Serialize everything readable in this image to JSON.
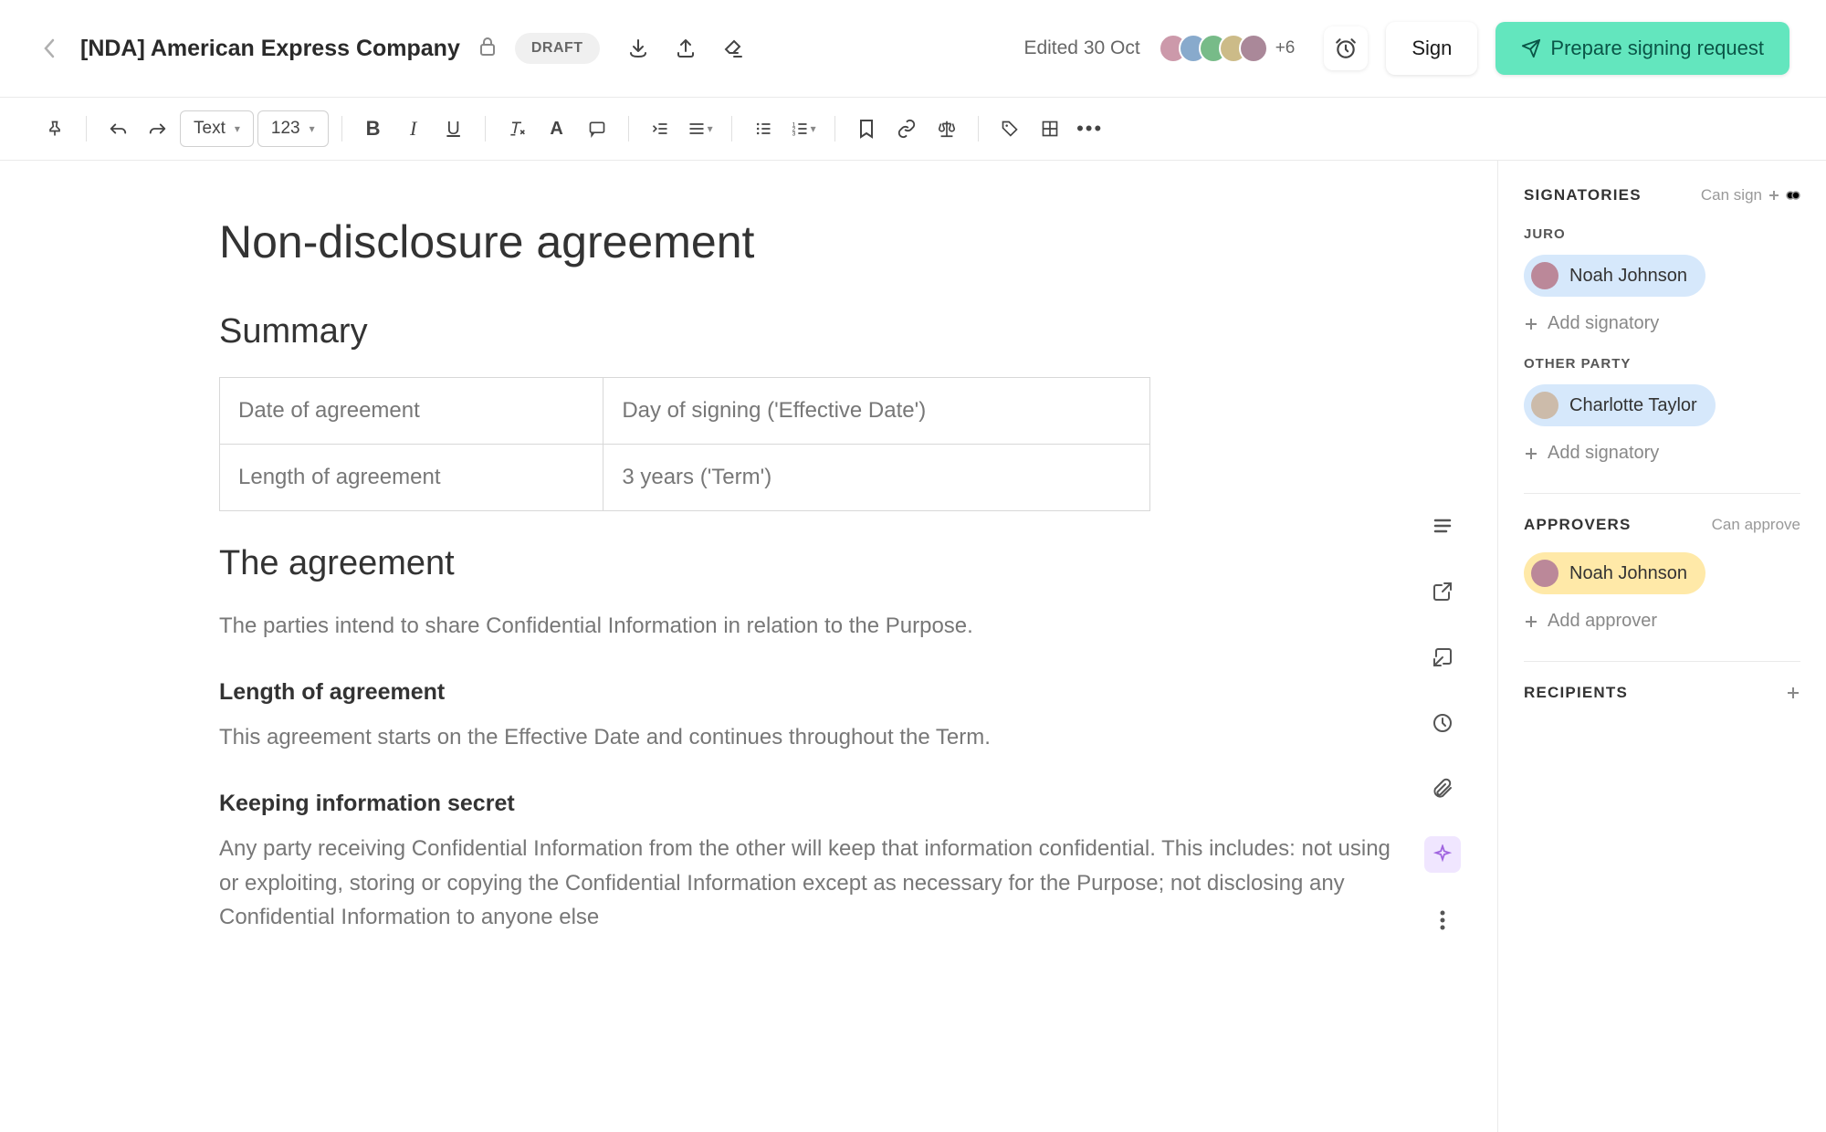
{
  "header": {
    "title": "[NDA] American Express Company",
    "badge": "DRAFT",
    "edited": "Edited 30 Oct",
    "avatar_more": "+6",
    "sign_label": "Sign",
    "prepare_label": "Prepare signing request"
  },
  "toolbar": {
    "style_select": "Text",
    "size_select": "123"
  },
  "document": {
    "h1": "Non-disclosure agreement",
    "h2_summary": "Summary",
    "table": {
      "r1c1": "Date of agreement",
      "r1c2": "Day of signing ('Effective Date')",
      "r2c1": "Length of agreement",
      "r2c2": "3 years ('Term')"
    },
    "h2_agreement": "The agreement",
    "p1": "The parties intend to share Confidential Information in relation to the Purpose.",
    "h3_length": "Length of agreement",
    "p2": "This agreement starts on the Effective Date and continues throughout the Term.",
    "h3_keeping": "Keeping information secret",
    "p3": "Any party receiving Confidential Information from the other will keep that information confidential. This includes: not using or exploiting, storing or copying the Confidential Information except as necessary for the Purpose; not disclosing any Confidential Information to anyone else"
  },
  "panel": {
    "signatories_title": "SIGNATORIES",
    "can_sign": "Can sign",
    "party1_label": "JURO",
    "party1_sig": "Noah Johnson",
    "party2_label": "OTHER PARTY",
    "party2_sig": "Charlotte Taylor",
    "add_signatory": "Add signatory",
    "approvers_title": "APPROVERS",
    "can_approve": "Can approve",
    "approver1": "Noah Johnson",
    "add_approver": "Add approver",
    "recipients_title": "RECIPIENTS"
  }
}
